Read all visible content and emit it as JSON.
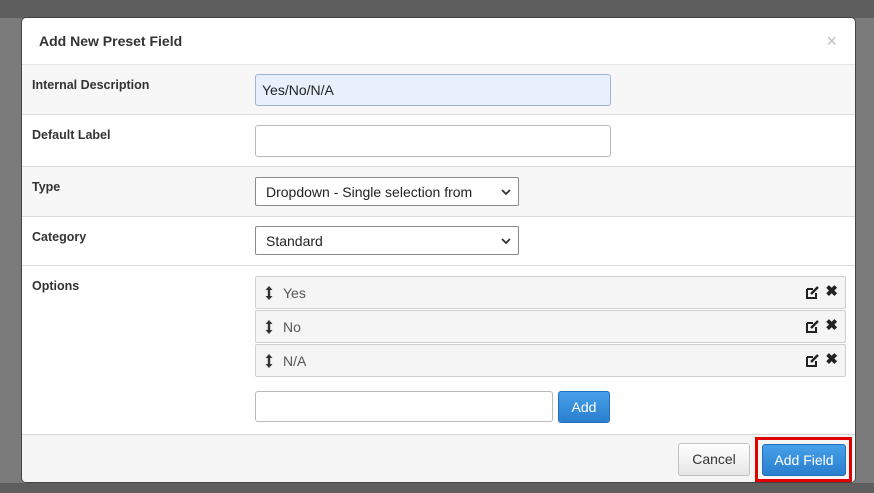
{
  "modal": {
    "title": "Add New Preset Field",
    "close_glyph": "×"
  },
  "fields": {
    "internal_description": {
      "label": "Internal Description",
      "value": "Yes/No/N/A"
    },
    "default_label": {
      "label": "Default Label",
      "value": ""
    },
    "type": {
      "label": "Type",
      "selected": "Dropdown - Single selection from"
    },
    "category": {
      "label": "Category",
      "selected": "Standard"
    },
    "options": {
      "label": "Options",
      "items": [
        {
          "label": "Yes"
        },
        {
          "label": "No"
        },
        {
          "label": "N/A"
        }
      ],
      "new_option_value": "",
      "add_label": "Add"
    }
  },
  "footer": {
    "cancel_label": "Cancel",
    "add_field_label": "Add Field"
  },
  "icons": {
    "drag": "vertical-arrows-icon",
    "edit": "edit-icon",
    "delete": "delete-x-icon",
    "dropdown": "chevron-down-icon"
  },
  "colors": {
    "primary_button": "#2a7fcf",
    "highlight_border": "#e00000",
    "autofill_input": "#e8f0fe"
  }
}
